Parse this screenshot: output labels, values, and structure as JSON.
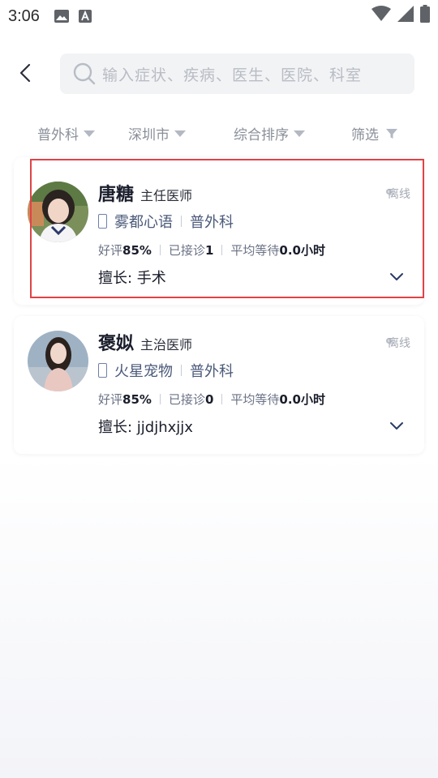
{
  "status_bar": {
    "time": "3:06"
  },
  "search": {
    "placeholder": "输入症状、疾病、医生、医院、科室"
  },
  "filters": {
    "department": "普外科",
    "city": "深圳市",
    "sort": "综合排序",
    "filter": "筛选"
  },
  "doctors": [
    {
      "name": "唐糖",
      "title": "主任医师",
      "status": "离线",
      "hospital": "雾都心语",
      "department": "普外科",
      "rating_label": "好评",
      "rating_value": "85%",
      "visits_label": "已接诊",
      "visits_value": "1",
      "wait_label": "平均等待",
      "wait_value": "0.0",
      "wait_unit": "小时",
      "specialty": "擅长: 手术"
    },
    {
      "name": "褒姒",
      "title": "主治医师",
      "status": "离线",
      "hospital": "火星宠物",
      "department": "普外科",
      "rating_label": "好评",
      "rating_value": "85%",
      "visits_label": "已接诊",
      "visits_value": "0",
      "wait_label": "平均等待",
      "wait_value": "0.0",
      "wait_unit": "小时",
      "specialty": "擅长: jjdjhxjjx"
    }
  ],
  "colors": {
    "highlight": "#e04346",
    "accent_text": "#4b5a7a"
  }
}
